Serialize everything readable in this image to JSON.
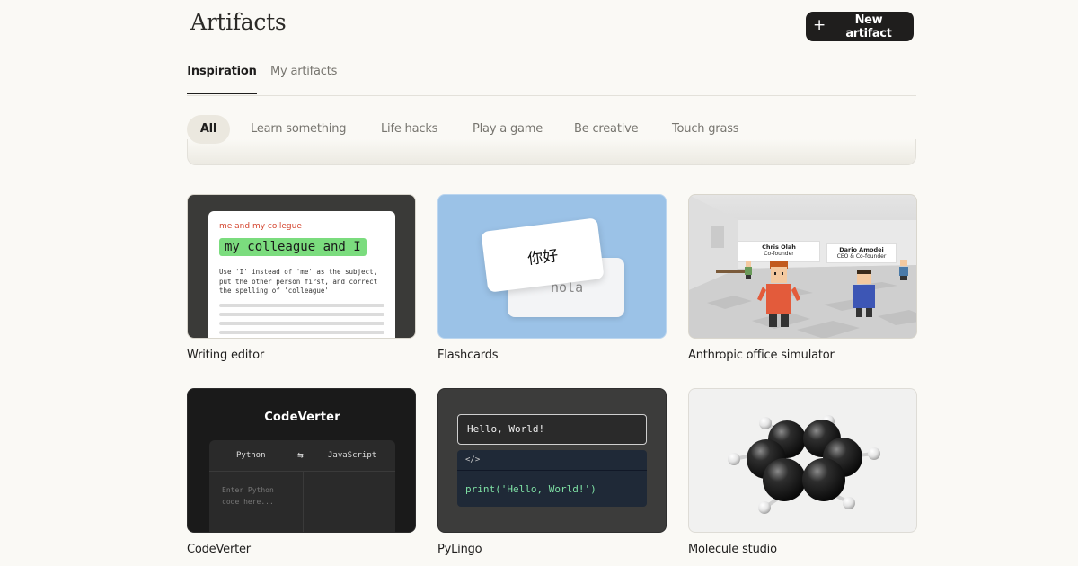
{
  "header": {
    "title": "Artifacts",
    "new_button_label": "New artifact"
  },
  "tabs": [
    {
      "label": "Inspiration",
      "active": true
    },
    {
      "label": "My artifacts",
      "active": false
    }
  ],
  "filters": [
    {
      "label": "All",
      "active": true
    },
    {
      "label": "Learn something",
      "active": false
    },
    {
      "label": "Life hacks",
      "active": false
    },
    {
      "label": "Play a game",
      "active": false
    },
    {
      "label": "Be creative",
      "active": false
    },
    {
      "label": "Touch grass",
      "active": false
    }
  ],
  "cards": [
    {
      "label": "Writing editor"
    },
    {
      "label": "Flashcards"
    },
    {
      "label": "Anthropic office simulator"
    },
    {
      "label": "CodeVerter"
    },
    {
      "label": "PyLingo"
    },
    {
      "label": "Molecule studio"
    }
  ],
  "thumb_writing": {
    "strike": "me and my collegue",
    "highlight": "my colleague and I",
    "note": "Use 'I' instead of 'me' as the subject, put the other person first, and correct the spelling of 'colleague'"
  },
  "thumb_flashcards": {
    "front": "你好",
    "back": "hola"
  },
  "thumb_office": {
    "sign1_name": "Chris Olah",
    "sign1_role": "Co-founder",
    "sign2_name": "Dario Amodei",
    "sign2_role": "CEO & Co-founder"
  },
  "thumb_codeverter": {
    "title": "CodeVerter",
    "from": "Python",
    "swap": "⇆",
    "to": "JavaScript",
    "placeholder_line1": "Enter Python",
    "placeholder_line2": "code here..."
  },
  "thumb_pylingo": {
    "input": "Hello, World!",
    "tag": "</>",
    "code": "print('Hello, World!')"
  },
  "colors": {
    "background": "#faf9f5",
    "button": "#1f1e1d",
    "chip_active": "#ebe8df",
    "flashcard_bg": "#9bc2e7"
  }
}
